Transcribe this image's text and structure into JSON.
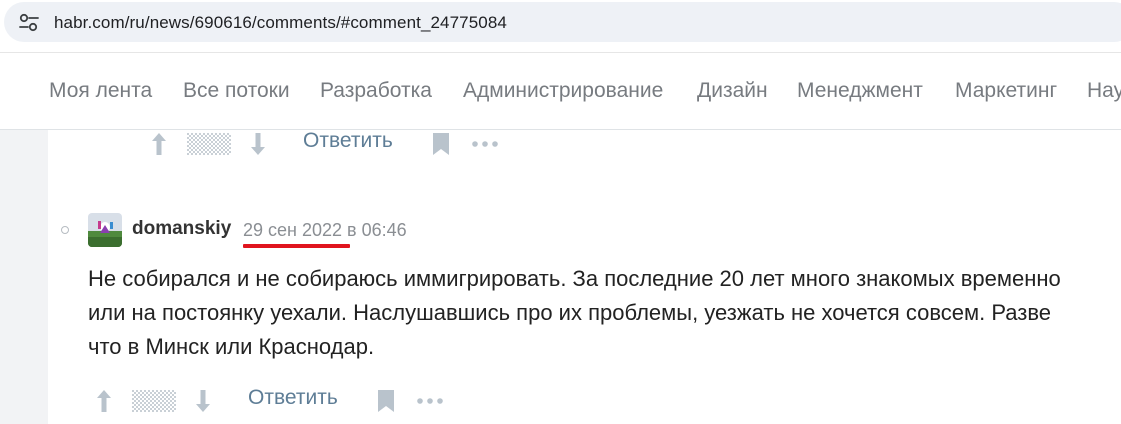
{
  "browser": {
    "url": "habr.com/ru/news/690616/comments/#comment_24775084"
  },
  "nav": {
    "items": [
      "Моя лента",
      "Все потоки",
      "Разработка",
      "Администрирование",
      "Дизайн",
      "Менеджмент",
      "Маркетинг",
      "Нау"
    ]
  },
  "previous_comment": {
    "reply_label": "Ответить"
  },
  "comment": {
    "author": "domanskiy",
    "timestamp": "29 сен 2022 в 06:46",
    "text": "Не собирался и не собираюсь иммигрировать. За последние 20 лет много знакомых временно или на постоянку уехали. Наслушавшись про их проблемы, уезжать не хочется совсем. Разве что в Минск или Краснодар.",
    "reply_label": "Ответить"
  },
  "colors": {
    "nav_text": "#777b80",
    "reply_link": "#5e7d96",
    "highlight_underline": "#e0141e"
  },
  "icons": [
    "tune-icon",
    "arrow-up-icon",
    "arrow-down-icon",
    "bookmark-icon",
    "more-icon"
  ]
}
